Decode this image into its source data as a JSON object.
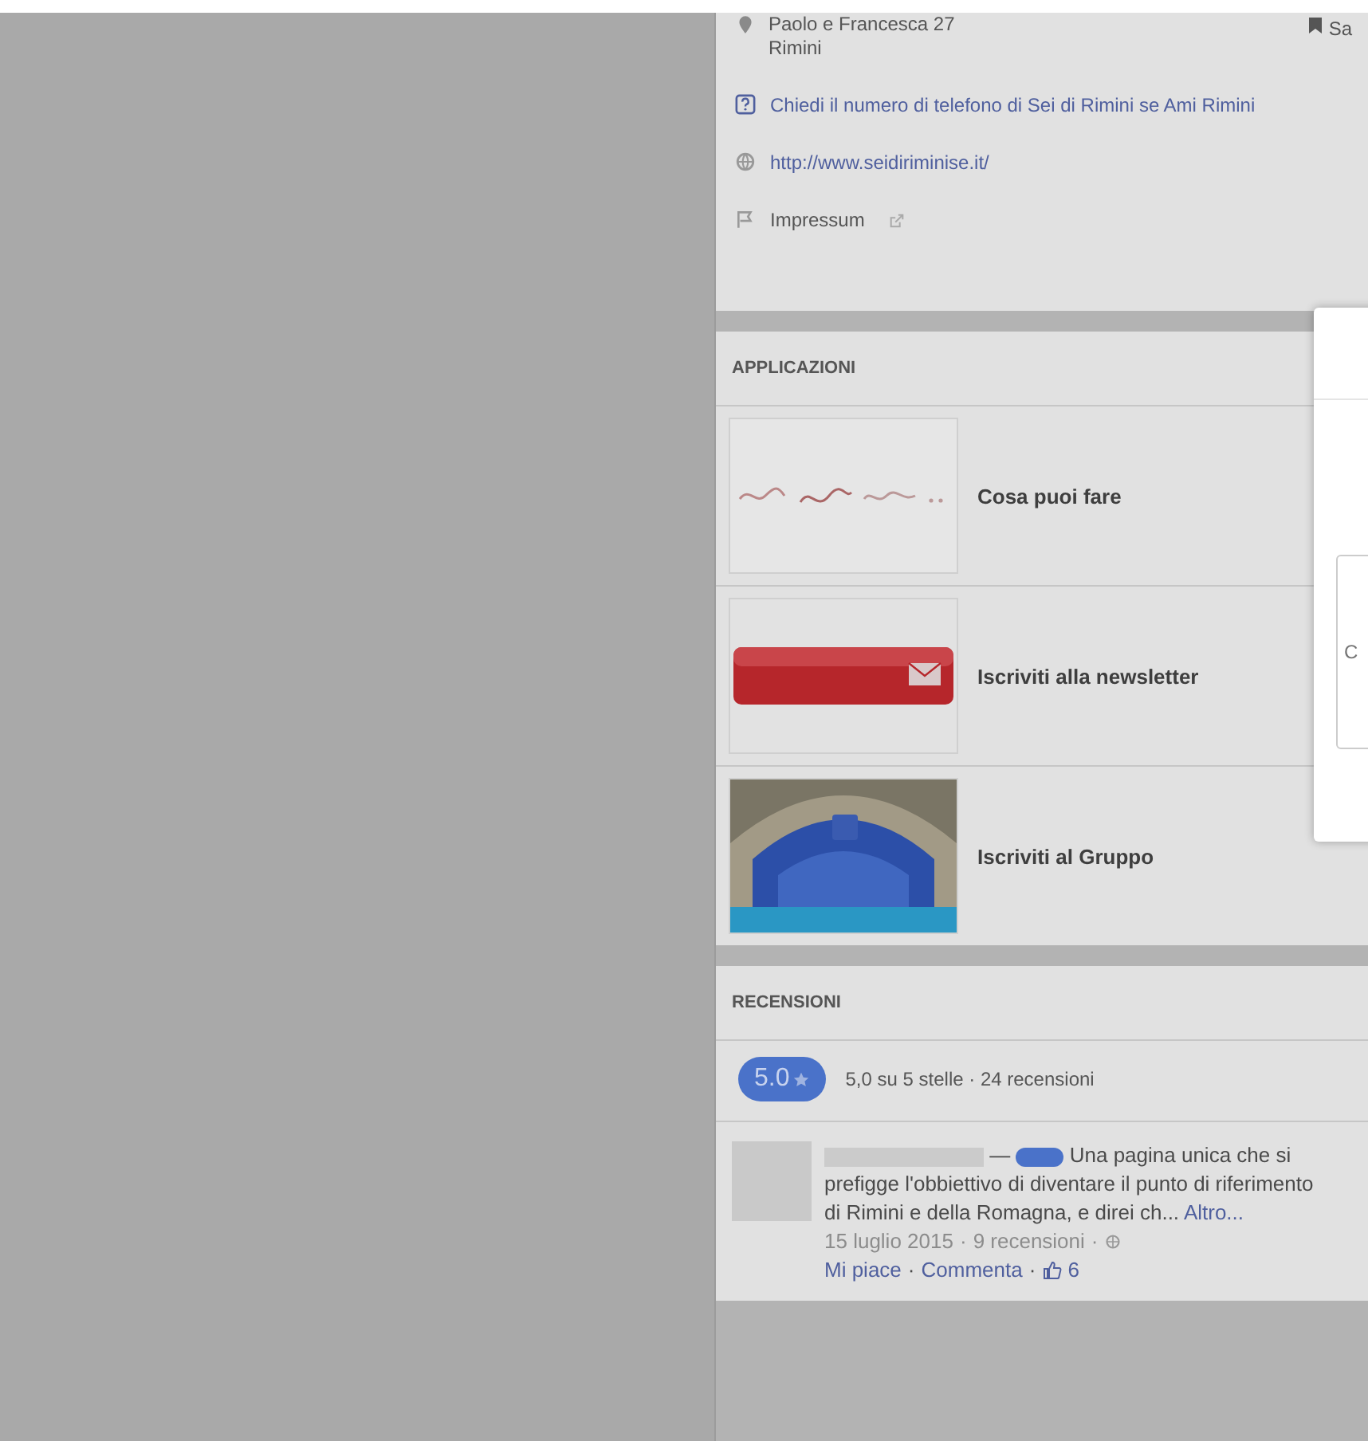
{
  "address": {
    "lines": [
      "Paolo e Francesca 27",
      "Rimini"
    ]
  },
  "save_button": {
    "label": "Sa"
  },
  "info_items": [
    {
      "kind": "ask",
      "text": "Chiedi il numero di telefono di Sei di Rimini se Ami Rimini"
    },
    {
      "kind": "web",
      "text": "http://www.seidiriminise.it/"
    },
    {
      "kind": "impressum",
      "text": "Impressum"
    }
  ],
  "apps": {
    "title": "APPLICAZIONI",
    "items": [
      {
        "label": "Cosa puoi fare"
      },
      {
        "label": "Iscriviti alla newsletter"
      },
      {
        "label": "Iscriviti al Gruppo"
      }
    ]
  },
  "reviews": {
    "title": "RECENSIONI",
    "score": "5.0",
    "summary": "5,0 su 5 stelle · 24 recensioni",
    "items": [
      {
        "text": "Una pagina unica che si prefigge l'obbiettivo di diventare il punto di riferimento di Rimini e della Romagna, e direi ch...",
        "more": "Altro...",
        "date": "15 luglio 2015",
        "count": "9 recensioni",
        "like": "Mi piace",
        "comment": "Commenta",
        "likes": "6",
        "dash": "—",
        "separator": "·"
      }
    ]
  },
  "dialog": {
    "placeholder": "C"
  }
}
